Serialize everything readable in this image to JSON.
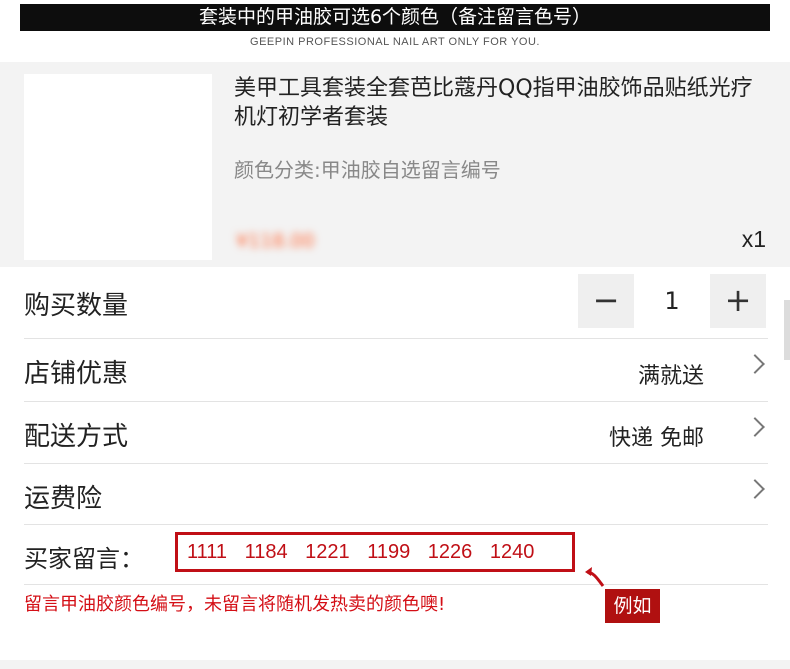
{
  "banner": {
    "text": "套装中的甲油胶可选6个颜色（备注留言色号）"
  },
  "subtitle": "GEEPIN PROFESSIONAL NAIL ART ONLY FOR YOU.",
  "product": {
    "title": "美甲工具套装全套芭比蔻丹QQ指甲油胶饰品贴纸光疗机灯初学者套装",
    "spec": "颜色分类:甲油胶自选留言编号",
    "price": "¥118.00",
    "quantity": "x1"
  },
  "purchase_qty": {
    "label": "购买数量",
    "minus": "−",
    "value": "1",
    "plus": "+"
  },
  "rows": [
    {
      "label": "店铺优惠",
      "value": "满就送"
    },
    {
      "label": "配送方式",
      "value": "快递 免邮"
    },
    {
      "label": "运费险",
      "value": ""
    }
  ],
  "message": {
    "label": "买家留言：",
    "value": "1111 1184 1221 1199 1226 1240"
  },
  "example_tag": "例如",
  "note": "留言甲油胶颜色编号，未留言将随机发热卖的颜色噢!",
  "colors": {
    "accent_red": "#c00f16",
    "tag_red": "#b01010",
    "banner_bg": "#0d0d0d"
  }
}
